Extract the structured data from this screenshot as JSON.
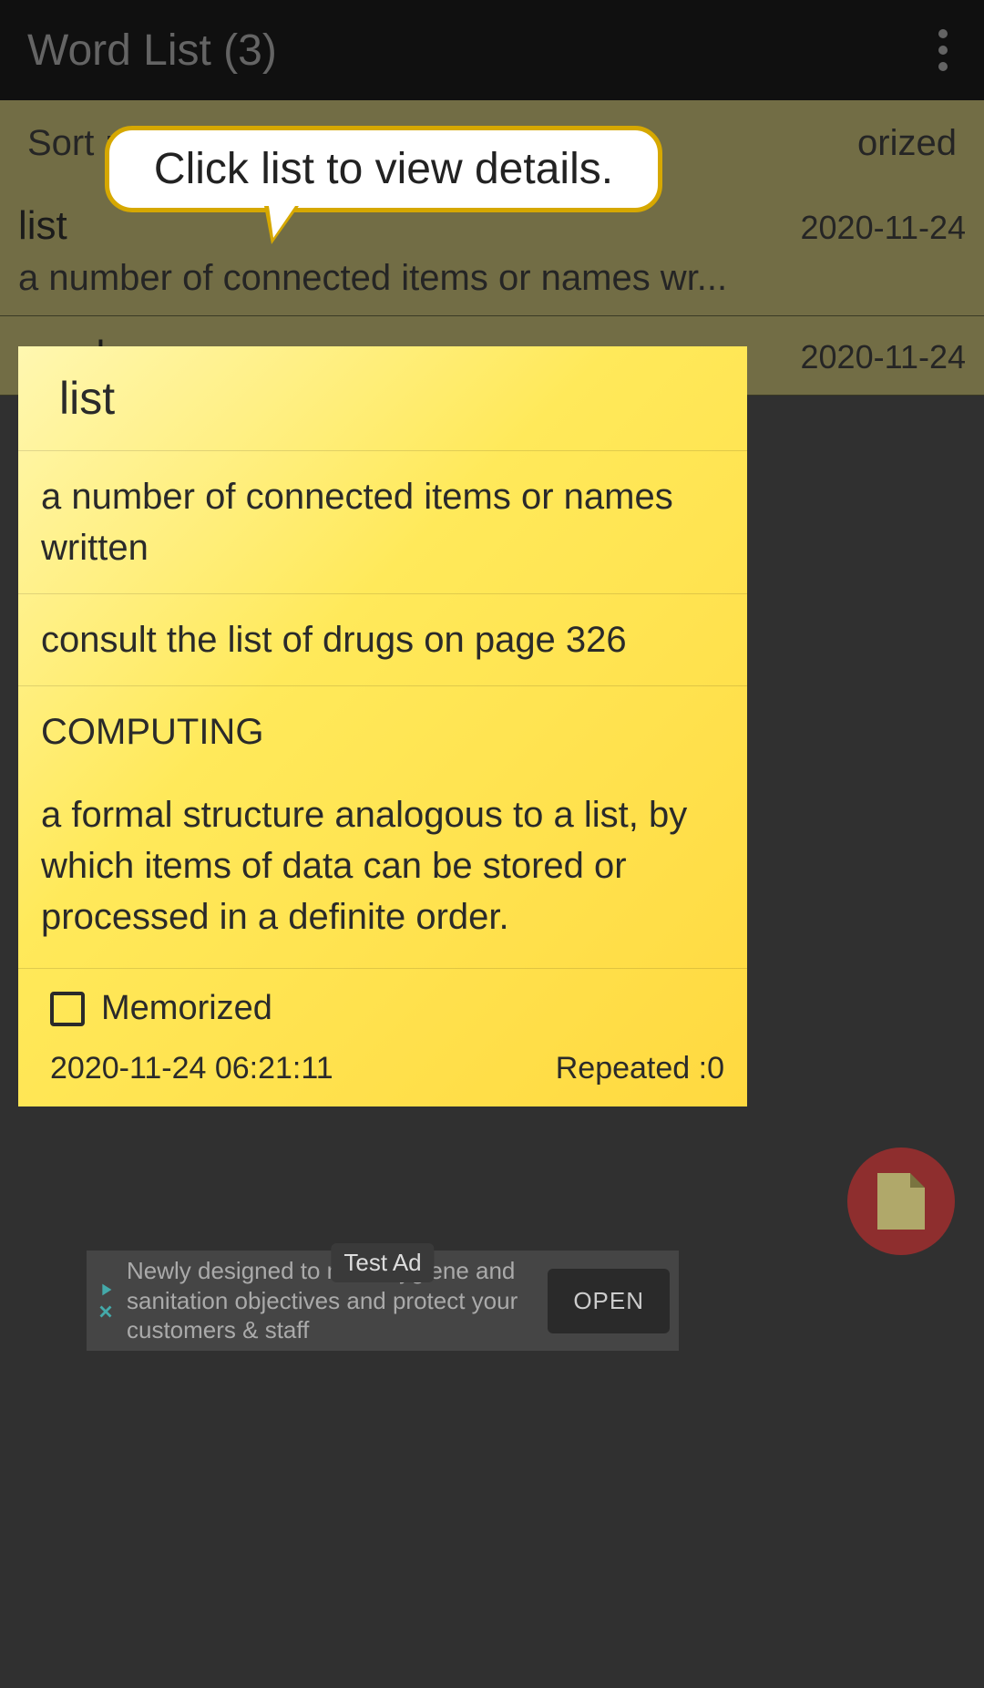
{
  "header": {
    "title": "Word List  (3)"
  },
  "sort": {
    "label": "Sort :",
    "right_partial": "orized"
  },
  "tooltip": {
    "text": "Click list to view details."
  },
  "words": [
    {
      "title": "list",
      "date": "2020-11-24",
      "definition": "a number of connected items or names wr..."
    },
    {
      "title": "word",
      "date": "2020-11-24",
      "definition": ""
    }
  ],
  "detail": {
    "word": "list",
    "definition1": "a number of connected items or names written",
    "example": "consult the list of drugs on page 326",
    "category": "COMPUTING",
    "definition2": "a formal structure analogous to a list, by which items of data can be stored or processed in a definite order.",
    "memorized_label": "Memorized",
    "timestamp": "2020-11-24 06:21:11",
    "repeated": "Repeated :0"
  },
  "ad": {
    "text": "Newly designed to meet hygiene and sanitation objectives and protect your customers & staff",
    "button": "OPEN",
    "badge": "Test Ad"
  }
}
